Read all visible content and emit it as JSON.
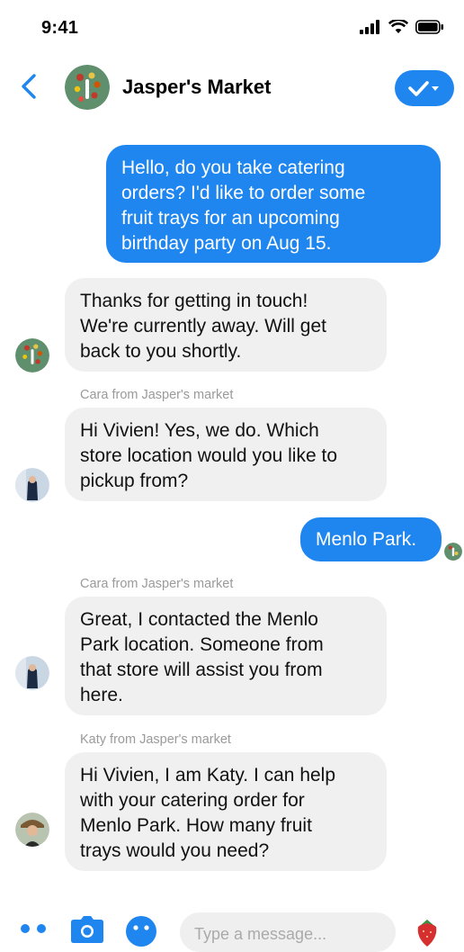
{
  "status_bar": {
    "time": "9:41"
  },
  "header": {
    "title": "Jasper's Market"
  },
  "messages": [
    {
      "lines": [
        "Hello, do you take catering",
        "orders?  I'd like to order some",
        "fruit trays for an upcoming",
        "birthday party on Aug 15."
      ]
    },
    {
      "lines": [
        "Thanks for getting in touch!",
        "We're currently away.  Will get",
        "back to you shortly."
      ]
    },
    {
      "sender": "Cara from Jasper's market",
      "lines": [
        "Hi Vivien!  Yes, we do.  Which",
        "store location would you like to",
        "pickup from?"
      ]
    },
    {
      "lines": [
        "Menlo Park."
      ]
    },
    {
      "sender": "Cara from Jasper's market",
      "lines": [
        "Great, I contacted the Menlo",
        "Park location.  Someone from",
        "that store will assist you from",
        "here."
      ]
    },
    {
      "sender": "Katy from Jasper's market",
      "lines": [
        "Hi Vivien, I am Katy. I can help",
        "with your catering order for",
        "Menlo Park.  How many fruit",
        "trays would you need?"
      ]
    }
  ],
  "composer": {
    "placeholder": "Type a message..."
  },
  "icons": {
    "back": "chevron-left-icon",
    "done": "checkmark-dropdown-icon",
    "more": "more-dots-icon",
    "camera": "camera-icon",
    "emoji": "emoji-icon",
    "sticker": "strawberry-icon"
  },
  "colors": {
    "accent": "#1f86f0",
    "incoming_bubble": "#f0f0f0"
  }
}
